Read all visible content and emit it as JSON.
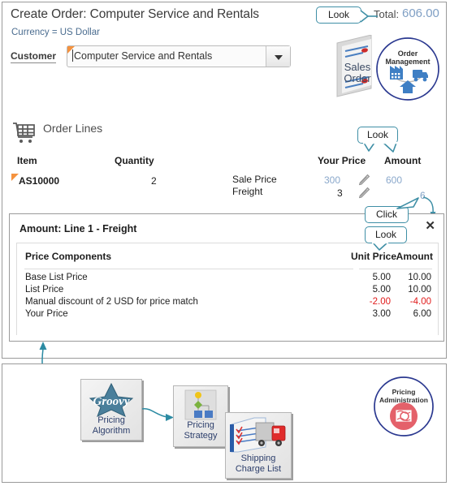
{
  "header": {
    "title": "Create Order: Computer Service and Rentals",
    "currency_line": "Currency = US Dollar",
    "total_label": "Total:",
    "total_value": "606.00"
  },
  "customer": {
    "label": "Customer",
    "value": "Computer Service and Rentals",
    "dropdown_icon": "chevron-down-icon",
    "required_flag": "required-marker"
  },
  "art": {
    "sales_order_line1": "Sales",
    "sales_order_line2": "Order",
    "order_management_line1": "Order",
    "order_management_line2": "Management",
    "pricing_admin_line1": "Pricing",
    "pricing_admin_line2": "Administration"
  },
  "order_lines": {
    "section_title": "Order Lines",
    "cart_icon": "shopping-cart-icon",
    "columns": {
      "item": "Item",
      "quantity": "Quantity",
      "your_price": "Your Price",
      "amount": "Amount"
    },
    "row": {
      "item": "AS10000",
      "quantity": "2",
      "charge_sale_label": "Sale Price",
      "charge_freight_label": "Freight",
      "sale_your_price": "300",
      "sale_amount": "600",
      "freight_your_price": "3",
      "freight_amount": "6",
      "edit_icon": "pencil-icon"
    }
  },
  "dialog": {
    "title": "Amount: Line 1 - Freight",
    "close_icon": "close-icon",
    "close_glyph": "✕",
    "columns": {
      "components": "Price Components",
      "unit_price": "Unit Price",
      "amount": "Amount"
    },
    "rows": [
      {
        "name": "Base List Price",
        "unit_price": "5.00",
        "amount": "10.00",
        "negative": false
      },
      {
        "name": "List Price",
        "unit_price": "5.00",
        "amount": "10.00",
        "negative": false
      },
      {
        "name": "Manual discount of 2 USD for price match",
        "unit_price": "-2.00",
        "amount": "-4.00",
        "negative": true
      },
      {
        "name": "Your Price",
        "unit_price": "3.00",
        "amount": "6.00",
        "negative": false
      }
    ]
  },
  "callouts": {
    "look_total": "Look",
    "look_columns": "Look",
    "click_amount": "Click",
    "look_dialog": "Look"
  },
  "bottom": {
    "pricing_algorithm_l1": "Pricing",
    "pricing_algorithm_l2": "Algorithm",
    "pricing_strategy_l1": "Pricing",
    "pricing_strategy_l2": "Strategy",
    "shipping_charge_l1": "Shipping",
    "shipping_charge_l2": "Charge List"
  },
  "colors": {
    "callout_border": "#3f8fa6",
    "link_blue": "#8aa8cb",
    "negative_red": "#e01b1b",
    "required_orange": "#f5923e",
    "badge_navy": "#2b3990",
    "badge_red": "#e4616a"
  }
}
